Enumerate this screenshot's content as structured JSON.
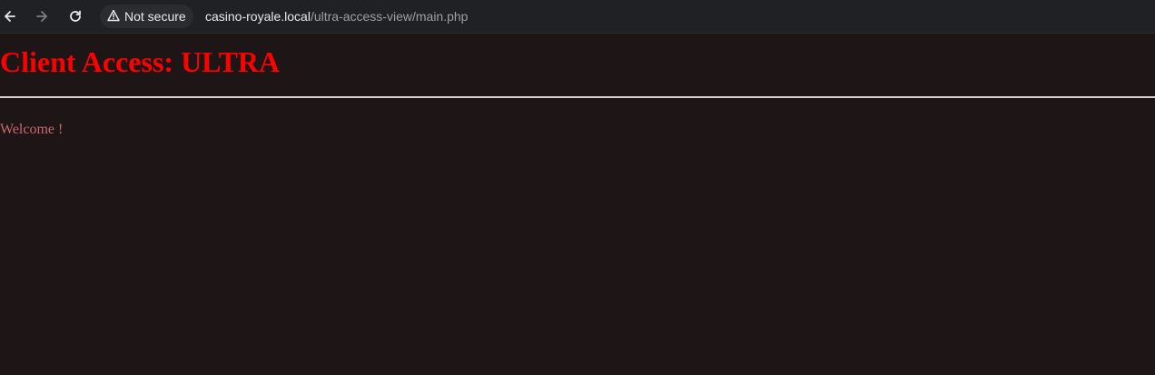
{
  "browser": {
    "security_label": "Not secure",
    "url_host": "casino-royale.local",
    "url_path": "/ultra-access-view/main.php",
    "icons": {
      "back": "arrow-left-icon",
      "forward": "arrow-right-icon",
      "reload": "reload-icon",
      "security": "warning-triangle-icon"
    }
  },
  "page": {
    "title": "Client Access: ULTRA",
    "welcome": "Welcome !",
    "colors": {
      "background": "#1e1616",
      "title": "#ff0000",
      "welcome": "#c9686e",
      "divider": "#d8d0d0"
    }
  }
}
